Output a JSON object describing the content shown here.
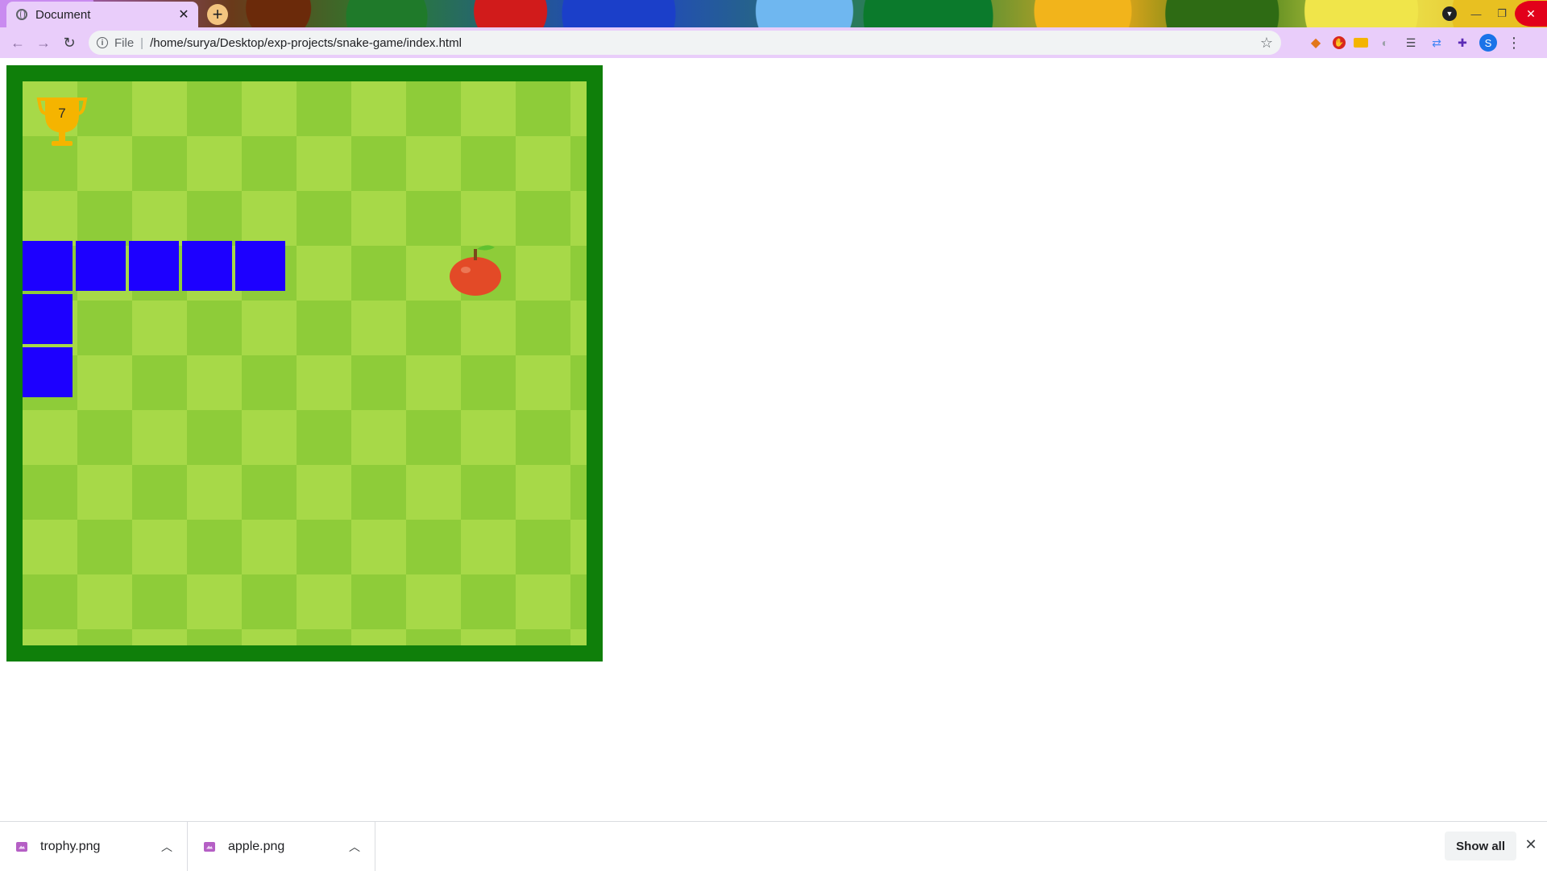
{
  "browser": {
    "tab_title": "Document",
    "tab_close": "✕",
    "new_tab": "+",
    "url_scheme": "File",
    "url_separator": "|",
    "url": "/home/surya/Desktop/exp-projects/snake-game/index.html",
    "avatar_letter": "S",
    "icons": {
      "back": "arrow-left-icon",
      "forward": "arrow-right-icon",
      "reload": "reload-icon",
      "info": "info-icon",
      "bookmark": "star-icon"
    }
  },
  "game": {
    "score": "7",
    "colors": {
      "border": "#0f7f0a",
      "tile_light": "#a7d948",
      "tile_dark": "#8ecc39",
      "snake": "#1d00ff",
      "apple": "#e34a27"
    }
  },
  "downloads": {
    "items": [
      {
        "name": "trophy.png"
      },
      {
        "name": "apple.png"
      }
    ],
    "show_all": "Show all",
    "close": "✕"
  }
}
